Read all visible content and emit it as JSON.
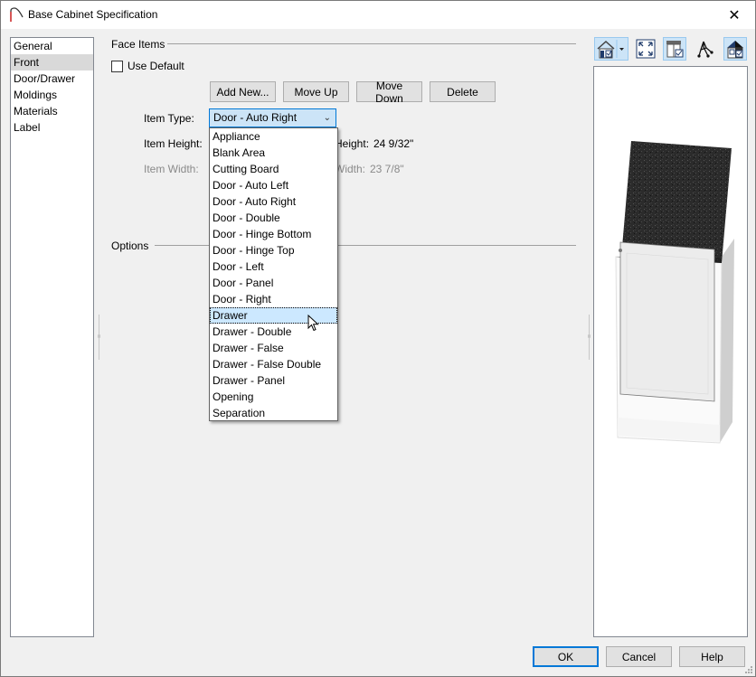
{
  "window": {
    "title": "Base Cabinet Specification",
    "close_label": "✕"
  },
  "sidebar": {
    "items": [
      {
        "label": "General",
        "selected": false
      },
      {
        "label": "Front",
        "selected": true
      },
      {
        "label": "Door/Drawer",
        "selected": false
      },
      {
        "label": "Moldings",
        "selected": false
      },
      {
        "label": "Materials",
        "selected": false
      },
      {
        "label": "Label",
        "selected": false
      }
    ]
  },
  "face_items": {
    "group_label": "Face Items",
    "use_default_label": "Use Default",
    "use_default_checked": false,
    "buttons": {
      "add_new": "Add New...",
      "move_up": "Move Up",
      "move_down": "Move Down",
      "delete": "Delete"
    },
    "item_type_label": "Item Type:",
    "item_type_value": "Door - Auto Right",
    "item_height_label": "Item Height:",
    "item_width_label": "Item Width:",
    "height_partial_label": "Height:",
    "height_value": "24 9/32\"",
    "width_partial_label": "Width:",
    "width_value": "23 7/8\""
  },
  "options": {
    "group_label": "Options"
  },
  "dropdown": {
    "hovered": "Drawer",
    "options": [
      "Appliance",
      "Blank Area",
      "Cutting Board",
      "Door - Auto Left",
      "Door - Auto Right",
      "Door - Double",
      "Door - Hinge Bottom",
      "Door - Hinge Top",
      "Door - Left",
      "Door - Panel",
      "Door - Right",
      "Drawer",
      "Drawer - Double",
      "Drawer - False",
      "Drawer - False Double",
      "Drawer - Panel",
      "Opening",
      "Separation"
    ]
  },
  "preview_toolbar": {
    "icons": [
      "camera-view-icon",
      "fill-window-icon",
      "cabinet-display-icon",
      "orbit-icon",
      "elevation-view-icon"
    ]
  },
  "footer": {
    "ok": "OK",
    "cancel": "Cancel",
    "help": "Help"
  },
  "colors": {
    "accent": "#0078d7",
    "selection": "#cce8ff",
    "countertop": "#2a2a2a"
  }
}
